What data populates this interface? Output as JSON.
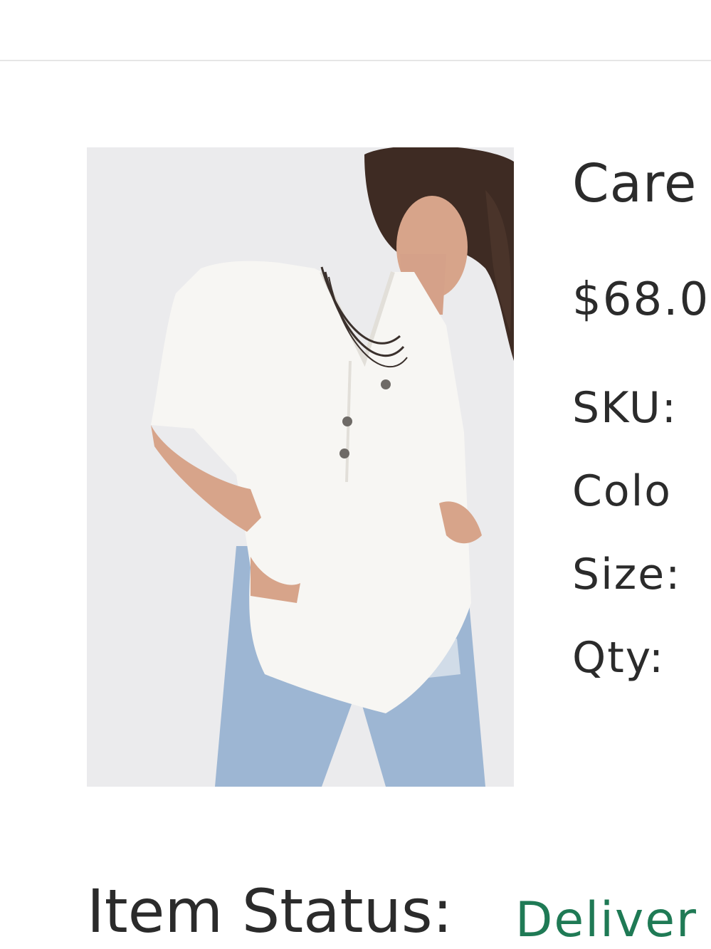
{
  "product": {
    "name": "Care",
    "price": "$68.0",
    "sku_label": "SKU:",
    "color_label": "Colo",
    "size_label": "Size:",
    "qty_label": "Qty:",
    "image_icon": "product-photo-white-henley-top"
  },
  "status": {
    "label": "Item Status:",
    "value": "Deliver",
    "value_color": "#1f7a55"
  }
}
